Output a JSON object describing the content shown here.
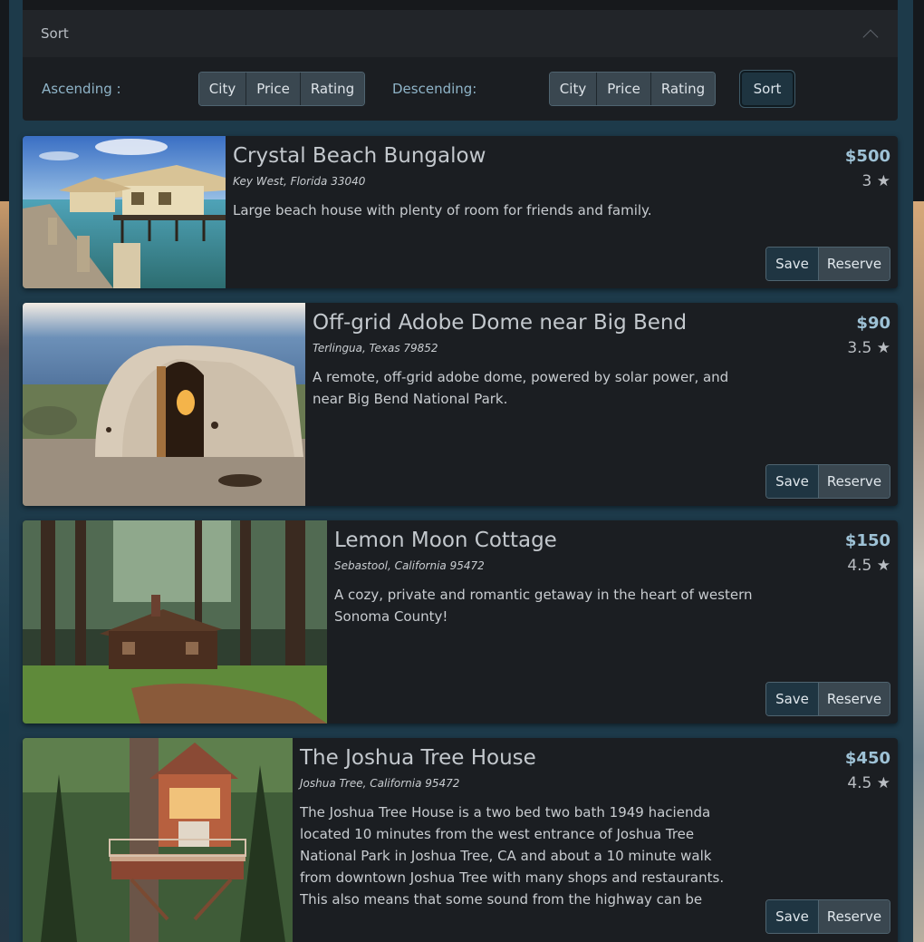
{
  "sort": {
    "title": "Sort",
    "ascending_label": "Ascending :",
    "descending_label": "Descending:",
    "ascending_options": [
      "City",
      "Price",
      "Rating"
    ],
    "descending_options": [
      "City",
      "Price",
      "Rating"
    ],
    "sort_button": "Sort"
  },
  "listings": [
    {
      "title": "Crystal Beach Bungalow",
      "address": "Key West, Florida 33040",
      "description": "Large beach house with plenty of room for friends and family.",
      "price": "$500",
      "rating": "3 ★",
      "save_label": "Save",
      "reserve_label": "Reserve"
    },
    {
      "title": "Off-grid Adobe Dome near Big Bend",
      "address": "Terlingua, Texas 79852",
      "description": "A remote, off-grid adobe dome, powered by solar power, and near Big Bend National Park.",
      "price": "$90",
      "rating": "3.5 ★",
      "save_label": "Save",
      "reserve_label": "Reserve"
    },
    {
      "title": "Lemon Moon Cottage",
      "address": "Sebastool, California 95472",
      "description": "A cozy, private and romantic getaway in the heart of western Sonoma County!",
      "price": "$150",
      "rating": "4.5 ★",
      "save_label": "Save",
      "reserve_label": "Reserve"
    },
    {
      "title": "The Joshua Tree House",
      "address": "Joshua Tree, California 95472",
      "description": "The Joshua Tree House is a two bed two bath 1949 hacienda located 10 minutes from the west entrance of Joshua Tree National Park in Joshua Tree, CA and about a 10 minute walk from downtown Joshua Tree with many shops and restaurants. This also means that some sound from the highway can be heard. If youre looking for a",
      "price": "$450",
      "rating": "4.5 ★",
      "save_label": "Save",
      "reserve_label": "Reserve"
    }
  ]
}
